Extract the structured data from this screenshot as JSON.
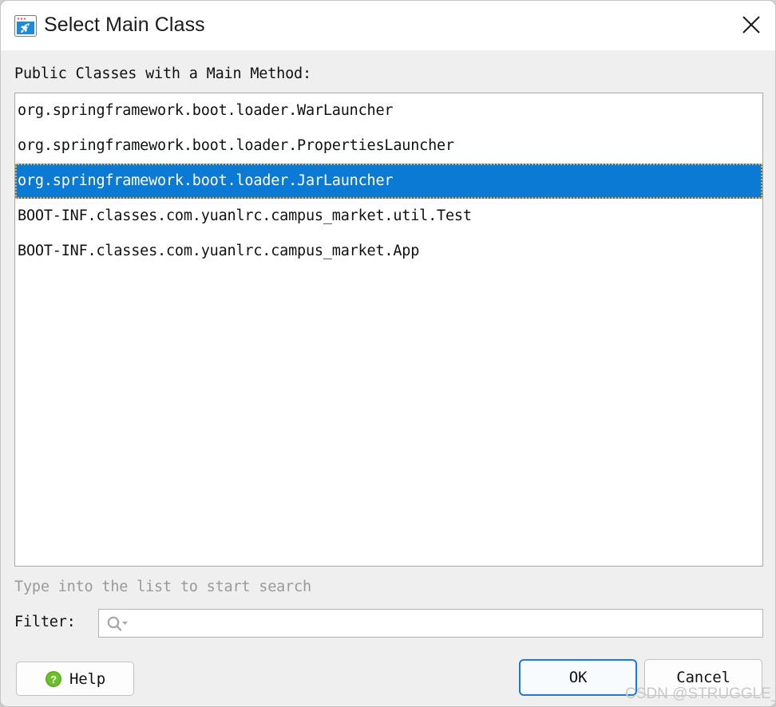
{
  "dialog": {
    "title": "Select Main Class",
    "icon": "run-configuration-icon",
    "close_label": "✕"
  },
  "list": {
    "label": "Public Classes with a Main Method:",
    "items": [
      {
        "text": "org.springframework.boot.loader.WarLauncher",
        "selected": false
      },
      {
        "text": "org.springframework.boot.loader.PropertiesLauncher",
        "selected": false
      },
      {
        "text": "org.springframework.boot.loader.JarLauncher",
        "selected": true
      },
      {
        "text": "BOOT-INF.classes.com.yuanlrc.campus_market.util.Test",
        "selected": false
      },
      {
        "text": "BOOT-INF.classes.com.yuanlrc.campus_market.App",
        "selected": false
      }
    ],
    "selected_index": 2,
    "selection_color": "#0a7ad4",
    "focus_outline_color": "#ffa726"
  },
  "search_hint": "Type into the list to start search",
  "filter": {
    "label": "Filter:",
    "value": "",
    "placeholder": "",
    "icon": "search-icon"
  },
  "buttons": {
    "help": "Help",
    "help_icon": "question-mark-icon",
    "ok": "OK",
    "cancel": "Cancel",
    "default_button_color": "#1a7ad4"
  },
  "watermark": "CSDN @STRUGGLE_xlf"
}
